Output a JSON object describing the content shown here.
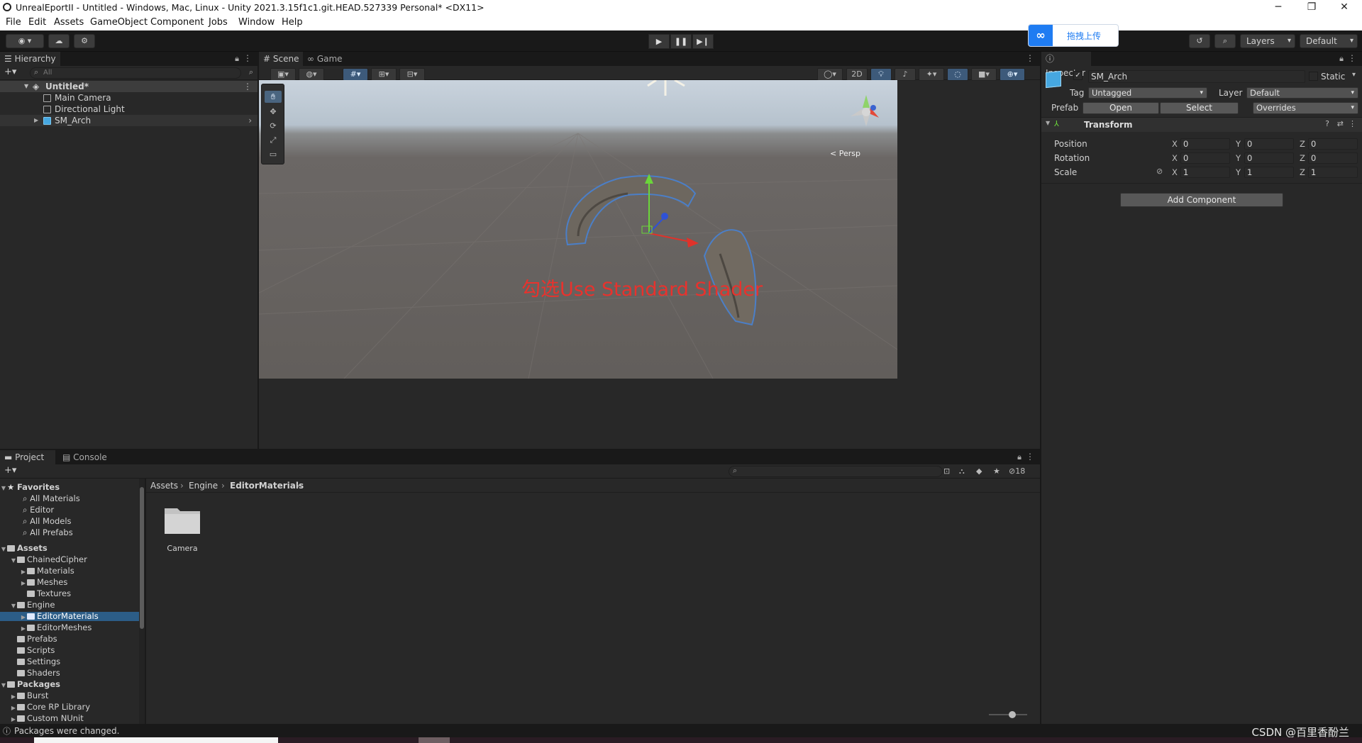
{
  "window": {
    "title": "UnrealEportII - Untitled - Windows, Mac, Linux - Unity 2021.3.15f1c1.git.HEAD.527339 Personal* <DX11>"
  },
  "menu": [
    "File",
    "Edit",
    "Assets",
    "GameObject",
    "Component",
    "Jobs",
    "Window",
    "Help"
  ],
  "toolbar": {
    "layers": "Layers",
    "layout": "Default"
  },
  "upload_widget": {
    "label": "拖拽上传"
  },
  "hierarchy": {
    "tab": "Hierarchy",
    "search_placeholder": "All",
    "scene": "Untitled*",
    "items": [
      "Main Camera",
      "Directional Light",
      "SM_Arch"
    ]
  },
  "scene": {
    "tabs": [
      "Scene",
      "Game"
    ],
    "toggle_2d": "2D",
    "persp_label": "< Persp",
    "overlay_text": "勾选Use Standard Shader",
    "overlay_color": "#e8322d"
  },
  "inspector": {
    "tab": "Inspector",
    "object_name": "SM_Arch",
    "static_label": "Static",
    "tag_label": "Tag",
    "tag_value": "Untagged",
    "layer_label": "Layer",
    "layer_value": "Default",
    "prefab_label": "Prefab",
    "prefab_open": "Open",
    "prefab_select": "Select",
    "prefab_overrides": "Overrides",
    "transform_title": "Transform",
    "position_label": "Position",
    "rotation_label": "Rotation",
    "scale_label": "Scale",
    "axis_x": "X",
    "axis_y": "Y",
    "axis_z": "Z",
    "position": [
      "0",
      "0",
      "0"
    ],
    "rotation": [
      "0",
      "0",
      "0"
    ],
    "scale": [
      "1",
      "1",
      "1"
    ],
    "add_component": "Add Component"
  },
  "project": {
    "tabs": [
      "Project",
      "Console"
    ],
    "hidden_count": "18",
    "breadcrumb": [
      "Assets",
      "Engine",
      "EditorMaterials"
    ],
    "favorites_title": "Favorites",
    "favorites": [
      "All Materials",
      "Editor",
      "All Models",
      "All Prefabs"
    ],
    "assets_title": "Assets",
    "assets": {
      "chained_cipher": "ChainedCipher",
      "materials": "Materials",
      "meshes": "Meshes",
      "textures": "Textures",
      "engine": "Engine",
      "editor_materials": "EditorMaterials",
      "editor_meshes": "EditorMeshes",
      "prefabs": "Prefabs",
      "scripts": "Scripts",
      "settings": "Settings",
      "shaders": "Shaders"
    },
    "packages_title": "Packages",
    "packages": [
      "Burst",
      "Core RP Library",
      "Custom NUnit"
    ],
    "grid_items": [
      "Camera"
    ]
  },
  "status": {
    "message": "Packages were changed.",
    "watermark": "CSDN @百里香酚兰"
  }
}
